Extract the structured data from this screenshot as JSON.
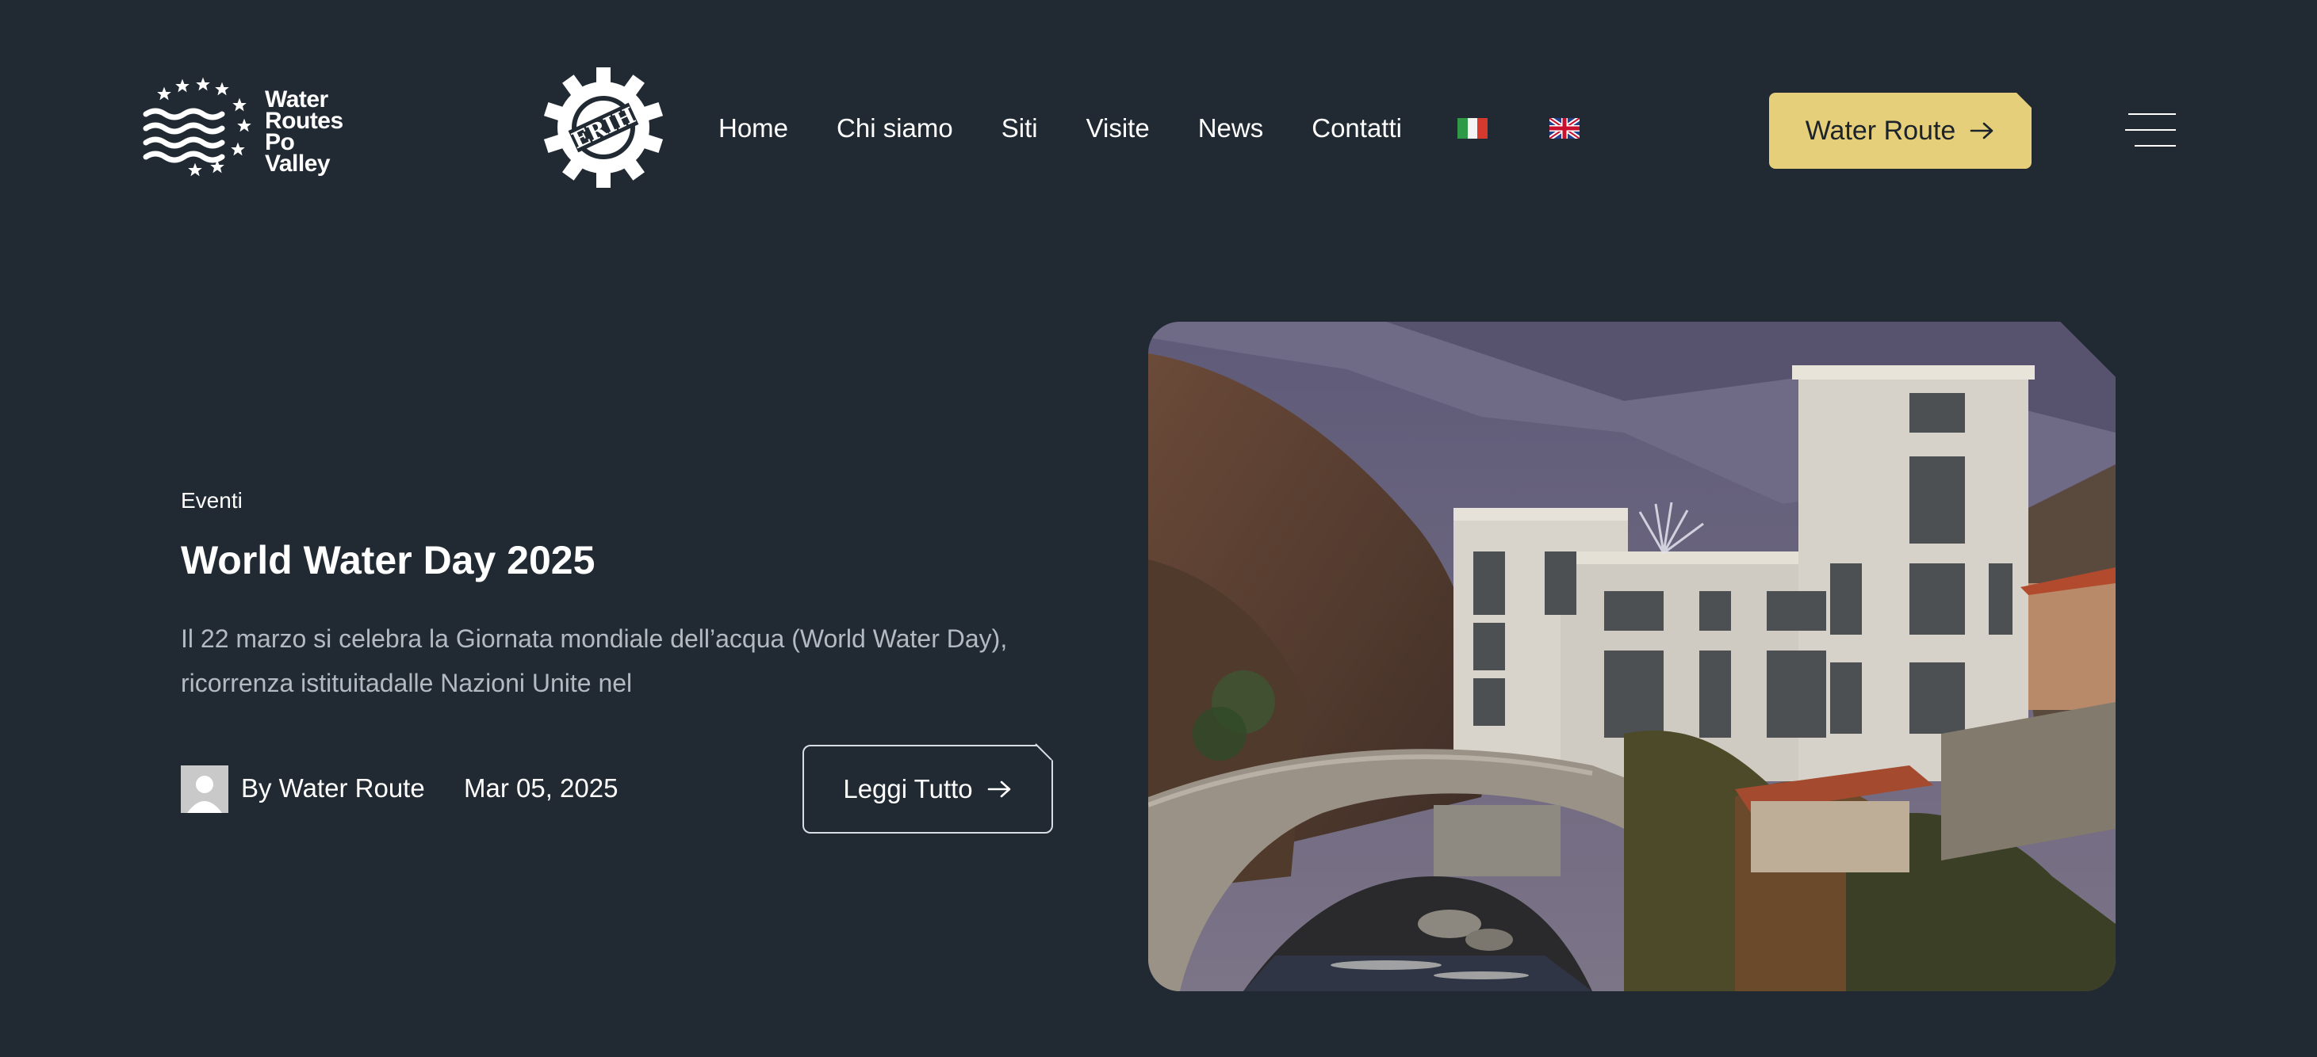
{
  "header": {
    "brand": {
      "line1": "Water",
      "line2": "Routes",
      "line3": "Po",
      "line4": "Valley"
    },
    "partner_logo": {
      "text": "ERIH"
    },
    "nav": [
      {
        "label": "Home"
      },
      {
        "label": "Chi siamo"
      },
      {
        "label": "Siti"
      },
      {
        "label": "Visite"
      },
      {
        "label": "News"
      },
      {
        "label": "Contatti"
      }
    ],
    "languages": [
      {
        "icon": "italy-flag-icon"
      },
      {
        "icon": "uk-flag-icon"
      }
    ],
    "cta_label": "Water Route",
    "menu_icon": "hamburger-menu-icon"
  },
  "article": {
    "category": "Eventi",
    "title": "World Water Day 2025",
    "excerpt": "Il 22 marzo si celebra la Giornata mondiale dell’acqua (World Water Day), ricorrenza istituitadalle Nazioni Unite nel",
    "author": "By Water Route",
    "date": "Mar 05, 2025",
    "read_more_label": "Leggi Tutto"
  },
  "colors": {
    "background": "#212a33",
    "accent": "#e6cf7a",
    "text": "#ffffff",
    "muted": "#b3bac2"
  }
}
